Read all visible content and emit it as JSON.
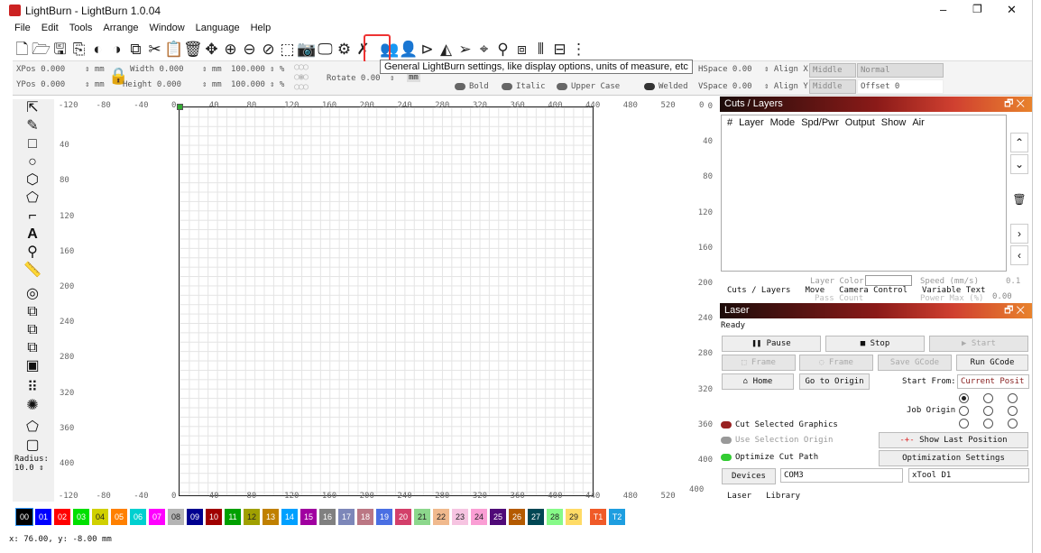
{
  "window": {
    "title": "LightBurn - LightBurn 1.0.04",
    "controls": [
      "–",
      "❐",
      "✕"
    ]
  },
  "menu": [
    "File",
    "Edit",
    "Tools",
    "Arrange",
    "Window",
    "Language",
    "Help"
  ],
  "toolbar_icons": [
    "new-file",
    "open-file",
    "save-file",
    "import",
    "undo",
    "redo",
    "copy",
    "cut",
    "paste",
    "delete",
    "move",
    "zoom-in",
    "zoom-out",
    "zoom-fit",
    "select-frame",
    "camera",
    "monitor",
    "settings",
    "tools",
    "users",
    "user",
    "align",
    "mirror",
    "send",
    "target",
    "node",
    "group",
    "break",
    "distribute",
    "spacer"
  ],
  "tooltip": "General LightBurn settings, like display options, units of measure, etc",
  "props": {
    "xpos": "XPos 0.000",
    "ypos": "YPos 0.000",
    "unit": "mm",
    "width": "Width 0.000",
    "height": "Height 0.000",
    "scale_w": "100.000",
    "scale_h": "100.000",
    "pct": "%",
    "rotate": "Rotate 0.00",
    "rotate_unit": "mm",
    "bold": "Bold",
    "italic": "Italic",
    "upper": "Upper Case",
    "welded": "Welded",
    "hspace": "HSpace 0.00",
    "vspace": "VSpace 0.00",
    "alignx": "Align X",
    "aligny": "Align Y",
    "alignx_val": "Middle",
    "aligny_val": "Middle",
    "normal": "Normal",
    "offset": "Offset 0"
  },
  "ruler_x": [
    "-120",
    "-80",
    "-40",
    "0",
    "40",
    "80",
    "120",
    "160",
    "200",
    "240",
    "280",
    "320",
    "360",
    "400",
    "440",
    "480",
    "520",
    "0"
  ],
  "ruler_y": [
    "40",
    "80",
    "120",
    "160",
    "200",
    "240",
    "280",
    "320",
    "360",
    "400"
  ],
  "ruler_x_bottom": [
    "-120",
    "-80",
    "-40",
    "0",
    "40",
    "80",
    "120",
    "160",
    "200",
    "240",
    "280",
    "320",
    "360",
    "400",
    "440",
    "480",
    "520",
    "400"
  ],
  "ruler_y_right": [
    "0",
    "40",
    "80",
    "120",
    "160",
    "200",
    "240",
    "280",
    "320",
    "360",
    "400"
  ],
  "left_tools_label": "Radius:",
  "radius_value": "10.0",
  "cuts": {
    "title": "Cuts / Layers",
    "columns": [
      "#",
      "Layer",
      "Mode",
      "Spd/Pwr",
      "Output",
      "Show",
      "Air"
    ],
    "hidden": [
      "Layer Color",
      "Speed (mm/s)",
      "0.1",
      "Pass Count",
      "Power Max (%)",
      "0.00"
    ],
    "tabs": [
      "Cuts / Layers",
      "Move",
      "Camera Control",
      "Variable Text"
    ]
  },
  "laser": {
    "title": "Laser",
    "status": "Ready",
    "pause": "Pause",
    "stop": "Stop",
    "start": "Start",
    "frame1": "Frame",
    "frame2": "Frame",
    "save_gcode": "Save GCode",
    "run_gcode": "Run GCode",
    "home": "Home",
    "go_origin": "Go to Origin",
    "start_from_label": "Start From:",
    "start_from": "Current Posit",
    "job_origin": "Job Origin",
    "cut_selected": "Cut Selected Graphics",
    "use_selection": "Use Selection Origin",
    "optimize": "Optimize Cut Path",
    "show_last": "Show Last Position",
    "opt_settings": "Optimization Settings",
    "devices": "Devices",
    "port": "COM3",
    "device": "xTool D1",
    "tabs": [
      "Laser",
      "Library"
    ]
  },
  "palette": [
    {
      "l": "00",
      "c": "#000000"
    },
    {
      "l": "01",
      "c": "#0000ff"
    },
    {
      "l": "02",
      "c": "#ff0000"
    },
    {
      "l": "03",
      "c": "#00e000"
    },
    {
      "l": "04",
      "c": "#d0d000"
    },
    {
      "l": "05",
      "c": "#ff8000"
    },
    {
      "l": "06",
      "c": "#00d0d0"
    },
    {
      "l": "07",
      "c": "#ff00ff"
    },
    {
      "l": "08",
      "c": "#b4b4b4"
    },
    {
      "l": "09",
      "c": "#000090"
    },
    {
      "l": "10",
      "c": "#a00000"
    },
    {
      "l": "11",
      "c": "#00a000"
    },
    {
      "l": "12",
      "c": "#a0a000"
    },
    {
      "l": "13",
      "c": "#c08000"
    },
    {
      "l": "14",
      "c": "#00a0ff"
    },
    {
      "l": "15",
      "c": "#a000a0"
    },
    {
      "l": "16",
      "c": "#808080"
    },
    {
      "l": "17",
      "c": "#7d87b9"
    },
    {
      "l": "18",
      "c": "#bb7784"
    },
    {
      "l": "19",
      "c": "#4a6fe3"
    },
    {
      "l": "20",
      "c": "#d33f6a"
    },
    {
      "l": "21",
      "c": "#8cd78c"
    },
    {
      "l": "22",
      "c": "#f0b98d"
    },
    {
      "l": "23",
      "c": "#f6c4e1"
    },
    {
      "l": "24",
      "c": "#fa9ed4"
    },
    {
      "l": "25",
      "c": "#500a78"
    },
    {
      "l": "26",
      "c": "#b45a00"
    },
    {
      "l": "27",
      "c": "#004754"
    },
    {
      "l": "28",
      "c": "#86fa88"
    },
    {
      "l": "29",
      "c": "#ffdb66"
    },
    {
      "l": "T1",
      "c": "#f05a28"
    },
    {
      "l": "T2",
      "c": "#1e9ee0"
    }
  ],
  "status": "x: 76.00, y: -8.00 mm"
}
